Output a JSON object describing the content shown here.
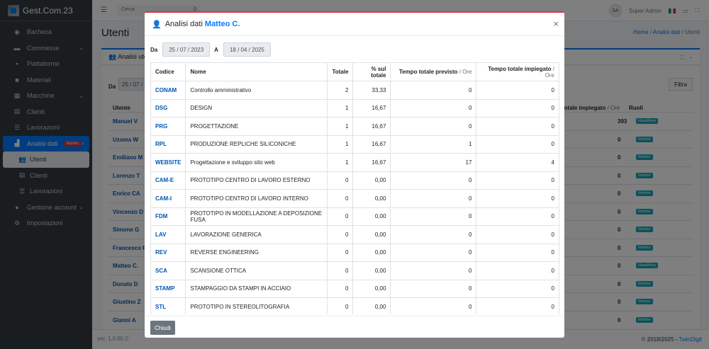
{
  "app": {
    "title": "Gest.Com.23",
    "version": "ver. 1.0.80.0",
    "copyright_prefix": "© 2018/2025 - ",
    "copyright_brand": "TwinDigit"
  },
  "sidebar": {
    "items": [
      {
        "label": "Bacheca",
        "icon": "dashboard-icon"
      },
      {
        "label": "Commesse",
        "icon": "briefcase-icon"
      },
      {
        "label": "Piattaforme",
        "icon": "truck-icon"
      },
      {
        "label": "Materiali",
        "icon": "box-icon"
      },
      {
        "label": "Macchine",
        "icon": "machine-icon"
      },
      {
        "label": "Clienti",
        "icon": "id-card-icon"
      },
      {
        "label": "Lavorazioni",
        "icon": "list-icon"
      },
      {
        "label": "Analisi dati",
        "icon": "chart-icon",
        "badge": "Nuovo"
      },
      {
        "label": "Utenti",
        "icon": "users-icon"
      },
      {
        "label": "Clienti",
        "icon": "id-card-icon"
      },
      {
        "label": "Lavorazioni",
        "icon": "list-icon"
      },
      {
        "label": "Gestione account",
        "icon": "user-gear-icon"
      },
      {
        "label": "Impostazioni",
        "icon": "gear-icon"
      }
    ]
  },
  "topbar": {
    "search_placeholder": "Cerca",
    "initials": "SA",
    "user": "Super Admin"
  },
  "page": {
    "title": "Utenti",
    "breadcrumb": [
      "Home",
      "Analisi dati",
      "Utenti"
    ]
  },
  "background_card": {
    "title": "Analisi ute",
    "da_label": "Da",
    "date_from": "25 / 07 /",
    "filtra": "Filtra",
    "col_user": "Utente",
    "col_total": "totale impiegato",
    "col_total_unit": "/ Ore",
    "col_roles": "Ruoli",
    "rows": [
      {
        "name": "Manuel V",
        "value": "393",
        "role": "HeadArea"
      },
      {
        "name": "Uzoma W",
        "value": "0",
        "role": "Worker"
      },
      {
        "name": "Emiliano M",
        "value": "0",
        "role": "Worker"
      },
      {
        "name": "Lorenzo T",
        "value": "0",
        "role": "Worker"
      },
      {
        "name": "Enrico CA",
        "value": "0",
        "role": "Worker"
      },
      {
        "name": "Vincenzo D",
        "value": "0",
        "role": "Worker"
      },
      {
        "name": "Simone G",
        "value": "0",
        "role": "Worker"
      },
      {
        "name": "Francesco P",
        "value": "0",
        "role": "Worker"
      },
      {
        "name": "Matteo C.",
        "value": "0",
        "role": "HeadArea"
      },
      {
        "name": "Donato D",
        "value": "0",
        "role": "Worker"
      },
      {
        "name": "Giustino Z",
        "value": "0",
        "role": "Worker"
      },
      {
        "name": "Gianni A",
        "value": "0",
        "role": "Worker"
      }
    ]
  },
  "modal": {
    "title_prefix": "Analisi dati",
    "user_name": "Matteo C.",
    "da_label": "Da",
    "a_label": "A",
    "date_from": "25 / 07 / 2023",
    "date_to": "18 / 04 / 2025",
    "close_label": "Chiudi",
    "headers": {
      "codice": "Codice",
      "nome": "Nome",
      "totale": "Totale",
      "perc": "% sul totale",
      "previsto": "Tempo totale previsto",
      "impiegato": "Tempo totale impiegato",
      "unit": "/ Ore"
    },
    "rows": [
      {
        "code": "CONAM",
        "name": "Controllo amministrativo",
        "total": "2",
        "perc": "33,33",
        "planned": "0",
        "spent": "0"
      },
      {
        "code": "DSG",
        "name": "DESIGN",
        "total": "1",
        "perc": "16,67",
        "planned": "0",
        "spent": "0"
      },
      {
        "code": "PRG",
        "name": "PROGETTAZIONE",
        "total": "1",
        "perc": "16,67",
        "planned": "0",
        "spent": "0"
      },
      {
        "code": "RPL",
        "name": "PRODUZIONE REPLICHE SILICONICHE",
        "total": "1",
        "perc": "16,67",
        "planned": "1",
        "spent": "0"
      },
      {
        "code": "WEBSITE",
        "name": "Progettazione e sviluppo sito web",
        "total": "1",
        "perc": "16,67",
        "planned": "17",
        "spent": "4"
      },
      {
        "code": "CAM-E",
        "name": "PROTOTIPO CENTRO DI LAVORO ESTERNO",
        "total": "0",
        "perc": "0,00",
        "planned": "0",
        "spent": "0"
      },
      {
        "code": "CAM-I",
        "name": "PROTOTIPO CENTRO DI LAVORO INTERNO",
        "total": "0",
        "perc": "0,00",
        "planned": "0",
        "spent": "0"
      },
      {
        "code": "FDM",
        "name": "PROTOTIPO IN MODELLAZIONE A DEPOSIZIONE FUSA",
        "total": "0",
        "perc": "0,00",
        "planned": "0",
        "spent": "0"
      },
      {
        "code": "LAV",
        "name": "LAVORAZIONE GENERICA",
        "total": "0",
        "perc": "0,00",
        "planned": "0",
        "spent": "0"
      },
      {
        "code": "REV",
        "name": "REVERSE ENGINEERING",
        "total": "0",
        "perc": "0,00",
        "planned": "0",
        "spent": "0"
      },
      {
        "code": "SCA",
        "name": "SCANSIONE OTTICA",
        "total": "0",
        "perc": "0,00",
        "planned": "0",
        "spent": "0"
      },
      {
        "code": "STAMP",
        "name": "STAMPAGGIO DA STAMPI IN ACCIAIO",
        "total": "0",
        "perc": "0,00",
        "planned": "0",
        "spent": "0"
      },
      {
        "code": "STL",
        "name": "PROTOTIPO IN STEREOLITOGRAFIA",
        "total": "0",
        "perc": "0,00",
        "planned": "0",
        "spent": "0"
      }
    ]
  }
}
